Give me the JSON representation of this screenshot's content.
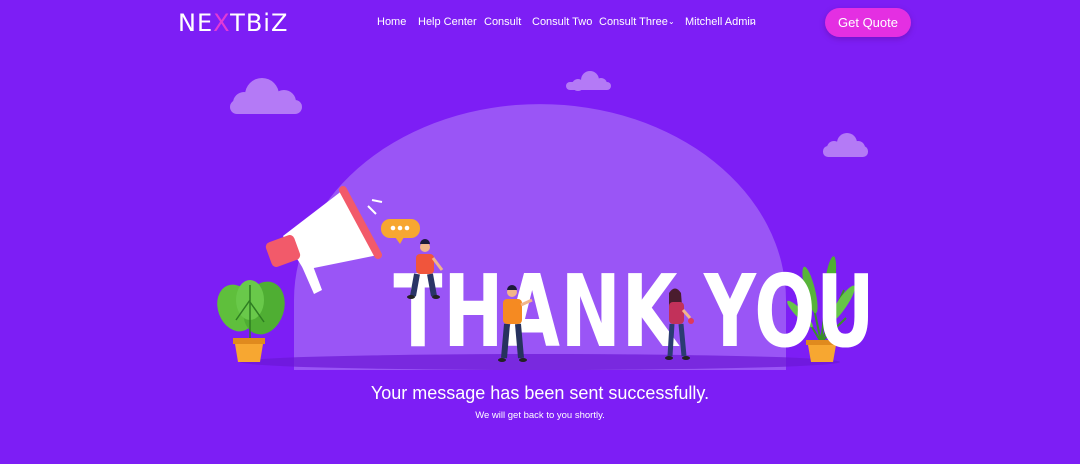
{
  "brand": {
    "logo_prefix": "NE",
    "logo_x": "X",
    "logo_suffix": "TBiZ"
  },
  "nav": {
    "items": [
      "Home",
      "Help Center",
      "Consult",
      "Consult Two",
      "Consult Three"
    ],
    "user_menu": "Mitchell Admin",
    "cta_label": "Get Quote"
  },
  "hero": {
    "title": "THANK YOU",
    "message": "Your message has been sent successfully.",
    "submessage": "We will get back to you shortly."
  },
  "icons": {
    "dropdown": "chevron-down-icon",
    "megaphone": "megaphone-icon",
    "speech": "speech-bubble-icon"
  },
  "colors": {
    "background": "#7d1ef5",
    "dome": "#9a55f6",
    "accent": "#e42fe2",
    "logo_x": "#e23ad6"
  }
}
